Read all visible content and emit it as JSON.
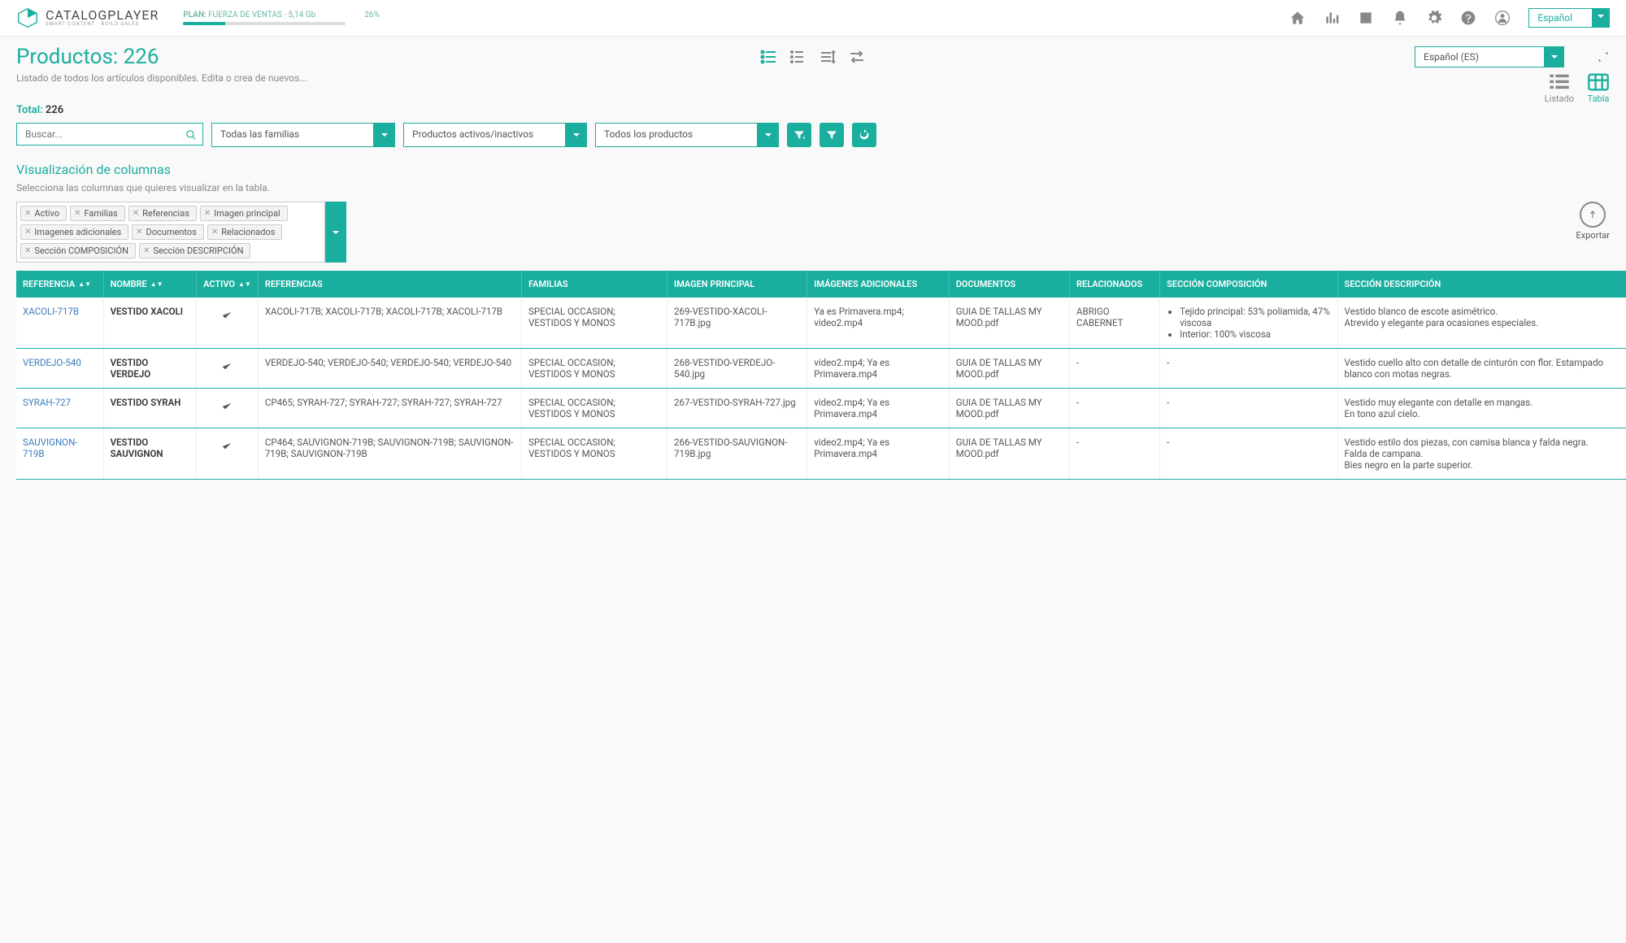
{
  "brand": {
    "title": "CATALOGPLAYER",
    "subtitle": "SMART CONTENT · BUILD SALES"
  },
  "plan": {
    "label": "PLAN:",
    "detail": "FUERZA DE VENTAS · 5,14 Gb",
    "percent": "26%",
    "fill": 26
  },
  "top_lang": "Español",
  "page": {
    "title_prefix": "Productos:",
    "count": "226",
    "lang": "Español (ES)"
  },
  "subtitle": "Listado de todos los artículos disponibles. Edita o crea de nuevos...",
  "view_toggle": {
    "list": "Listado",
    "table": "Tabla"
  },
  "totals": {
    "label": "Total:",
    "value": "226"
  },
  "filters": {
    "search_placeholder": "Buscar...",
    "families": "Todas las familias",
    "active": "Productos activos/inactivos",
    "products": "Todos los productos"
  },
  "columns_section": {
    "title": "Visualización de columnas",
    "subtitle": "Selecciona las columnas que quieres visualizar en la tabla.",
    "tags": [
      "Activo",
      "Familias",
      "Referencias",
      "Imagen principal",
      "Imagenes adicionales",
      "Documentos",
      "Relacionados",
      "Sección COMPOSICIÓN",
      "Sección DESCRIPCIÓN"
    ],
    "export": "Exportar"
  },
  "table": {
    "headers": [
      "REFERENCIA",
      "NOMBRE",
      "ACTIVO",
      "REFERENCIAS",
      "FAMILIAS",
      "IMAGEN PRINCIPAL",
      "IMÁGENES ADICIONALES",
      "DOCUMENTOS",
      "RELACIONADOS",
      "SECCIÓN COMPOSICIÓN",
      "SECCIÓN DESCRIPCIÓN"
    ],
    "rows": [
      {
        "ref": "XACOLI-717B",
        "name": "VESTIDO XACOLI",
        "active": true,
        "refs": "XACOLI-717B; XACOLI-717B; XACOLI-717B; XACOLI-717B",
        "families": "SPECIAL OCCASION; VESTIDOS Y MONOS",
        "main_img": "269-VESTIDO-XACOLI-717B.jpg",
        "extra_imgs": "Ya es Primavera.mp4; video2.mp4",
        "docs": "GUIA DE TALLAS MY MOOD.pdf",
        "related": "ABRIGO CABERNET",
        "composition": [
          "Tejido principal: 53% poliamida, 47% viscosa",
          "Interior: 100% viscosa"
        ],
        "description": "Vestido blanco de escote asimétrico.\nAtrevido y elegante para ocasiones especiales."
      },
      {
        "ref": "VERDEJO-540",
        "name": "VESTIDO VERDEJO",
        "active": true,
        "refs": "VERDEJO-540; VERDEJO-540; VERDEJO-540; VERDEJO-540",
        "families": "SPECIAL OCCASION; VESTIDOS Y MONOS",
        "main_img": "268-VESTIDO-VERDEJO-540.jpg",
        "extra_imgs": "video2.mp4; Ya es Primavera.mp4",
        "docs": "GUIA DE TALLAS MY MOOD.pdf",
        "related": "-",
        "composition": "-",
        "description": "Vestido cuello alto con detalle de cinturón con flor. Estampado blanco con motas negras."
      },
      {
        "ref": "SYRAH-727",
        "name": "VESTIDO SYRAH",
        "active": true,
        "refs": "CP465; SYRAH-727; SYRAH-727; SYRAH-727; SYRAH-727",
        "families": "SPECIAL OCCASION; VESTIDOS Y MONOS",
        "main_img": "267-VESTIDO-SYRAH-727.jpg",
        "extra_imgs": "video2.mp4; Ya es Primavera.mp4",
        "docs": "GUIA DE TALLAS MY MOOD.pdf",
        "related": "-",
        "composition": "-",
        "description": "Vestido muy elegante con detalle en mangas.\nEn tono azul cielo."
      },
      {
        "ref": "SAUVIGNON-719B",
        "name": "VESTIDO SAUVIGNON",
        "active": true,
        "refs": "CP464; SAUVIGNON-719B; SAUVIGNON-719B; SAUVIGNON-719B; SAUVIGNON-719B",
        "families": "SPECIAL OCCASION; VESTIDOS Y MONOS",
        "main_img": "266-VESTIDO-SAUVIGNON-719B.jpg",
        "extra_imgs": "video2.mp4; Ya es Primavera.mp4",
        "docs": "GUIA DE TALLAS MY MOOD.pdf",
        "related": "-",
        "composition": "-",
        "description": "Vestido estilo dos piezas, con camisa blanca y falda negra.\nFalda de campana.\nBies negro en la parte superior."
      }
    ]
  }
}
